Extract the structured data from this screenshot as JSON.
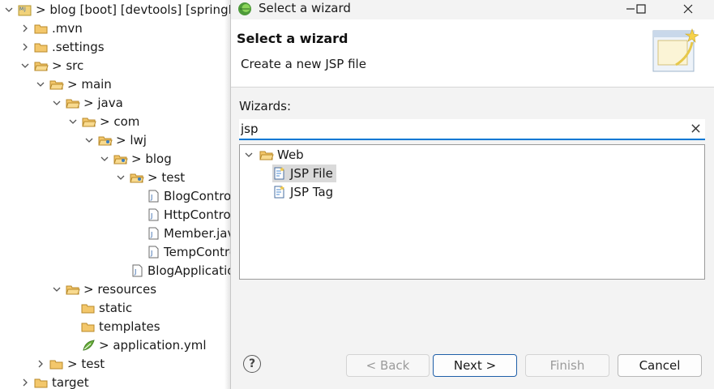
{
  "explorer": {
    "items": [
      {
        "label": "> blog [boot] [devtools] [springBoot]",
        "icon": "maven-project-icon",
        "expanded": true
      },
      {
        "label": ".mvn",
        "icon": "folder-icon",
        "expanded": false
      },
      {
        "label": ".settings",
        "icon": "folder-icon",
        "expanded": false
      },
      {
        "label": "> src",
        "icon": "folder-icon",
        "expanded": true
      },
      {
        "label": "> main",
        "icon": "folder-icon",
        "expanded": true
      },
      {
        "label": "> java",
        "icon": "folder-icon",
        "expanded": true
      },
      {
        "label": "> com",
        "icon": "folder-icon",
        "expanded": true
      },
      {
        "label": "> lwj",
        "icon": "package-folder-icon",
        "expanded": true
      },
      {
        "label": "> blog",
        "icon": "package-folder-icon",
        "expanded": true
      },
      {
        "label": "> test",
        "icon": "package-folder-icon",
        "expanded": true
      },
      {
        "label": "BlogController.java",
        "icon": "java-file-icon"
      },
      {
        "label": "HttpControllerTest.java",
        "icon": "java-file-icon"
      },
      {
        "label": "Member.java",
        "icon": "java-file-icon"
      },
      {
        "label": "TempController.java",
        "icon": "java-file-icon"
      },
      {
        "label": "BlogApplication.java",
        "icon": "java-file-icon"
      },
      {
        "label": "> resources",
        "icon": "folder-icon",
        "expanded": true
      },
      {
        "label": "static",
        "icon": "folder-icon"
      },
      {
        "label": "templates",
        "icon": "folder-icon"
      },
      {
        "label": "> application.yml",
        "icon": "spring-yml-icon"
      },
      {
        "label": "> test",
        "icon": "folder-icon",
        "expanded": false
      },
      {
        "label": "target",
        "icon": "folder-icon",
        "expanded": false
      }
    ]
  },
  "dialog": {
    "window_title": "Select a wizard",
    "header_title": "Select a wizard",
    "header_description": "Create a new JSP file",
    "wizards_label": "Wizards:",
    "filter_value": "jsp",
    "tree": [
      {
        "label": "Web",
        "icon": "open-folder-icon"
      },
      {
        "label": "JSP File",
        "icon": "jsp-file-icon",
        "selected": true
      },
      {
        "label": "JSP Tag",
        "icon": "jsp-tag-icon"
      }
    ],
    "buttons": {
      "help": "?",
      "back": "< Back",
      "next": "Next >",
      "finish": "Finish",
      "cancel": "Cancel"
    },
    "accent_color": "#0078d4"
  }
}
